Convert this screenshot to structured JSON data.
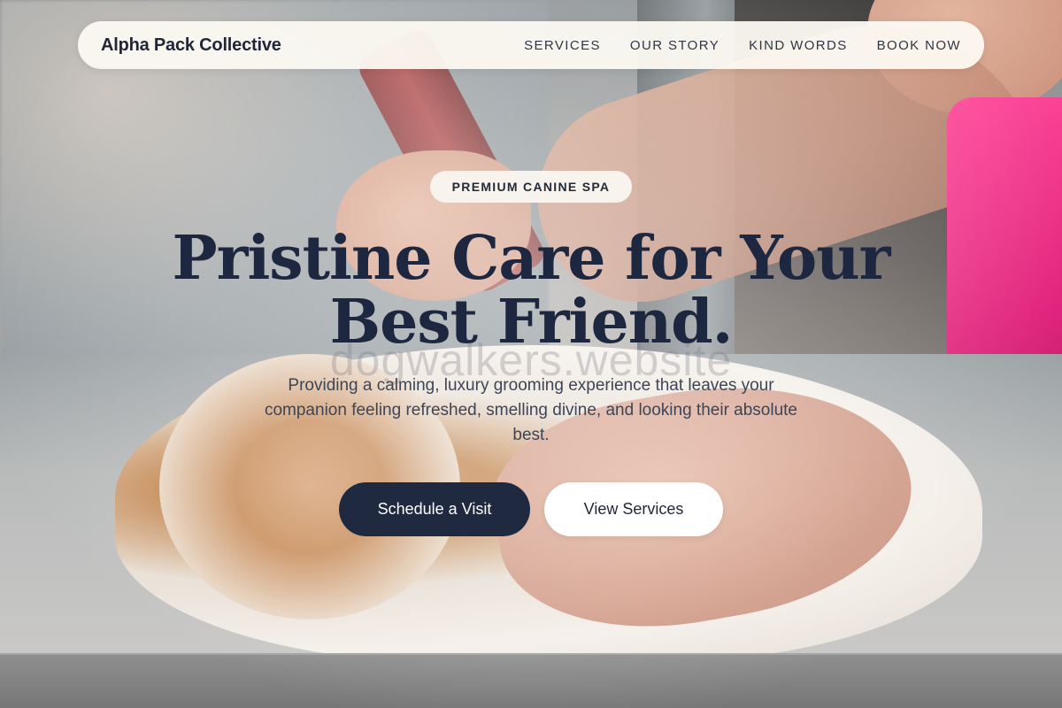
{
  "nav": {
    "brand": "Alpha Pack Collective",
    "links": [
      {
        "label": "SERVICES"
      },
      {
        "label": "OUR STORY"
      },
      {
        "label": "KIND WORDS"
      },
      {
        "label": "BOOK NOW"
      }
    ]
  },
  "hero": {
    "badge": "PREMIUM CANINE SPA",
    "headline": "Pristine Care for Your Best Friend.",
    "watermark": "dogwalkers.website",
    "subtitle": "Providing a calming, luxury grooming experience that leaves your companion feeling refreshed, smelling divine, and looking their absolute best.",
    "primary_cta": "Schedule a Visit",
    "secondary_cta": "View Services"
  },
  "colors": {
    "navy": "#1f2a40",
    "cream": "#fcf9f2",
    "accent_pink": "#e01e7a"
  }
}
